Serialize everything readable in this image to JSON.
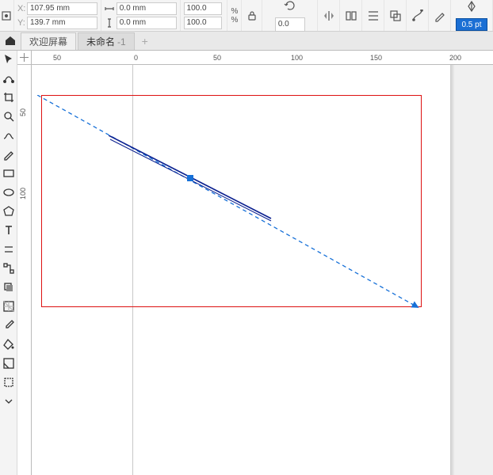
{
  "propbar": {
    "x_label": "X:",
    "y_label": "Y:",
    "x_value": "107.95 mm",
    "y_value": "139.7 mm",
    "w_value": "0.0 mm",
    "h_value": "0.0 mm",
    "scale_x": "100.0",
    "scale_y": "100.0",
    "pct": "%",
    "rotation": "0.0",
    "stroke_width": "0.5 pt"
  },
  "tabs": {
    "welcome": "欢迎屏幕",
    "doc_name": "未命名",
    "doc_suffix": "-1"
  },
  "ruler": {
    "h": [
      "0",
      "50",
      "100",
      "150",
      "200"
    ],
    "h_neg": "50",
    "v": [
      "50",
      "100"
    ]
  }
}
